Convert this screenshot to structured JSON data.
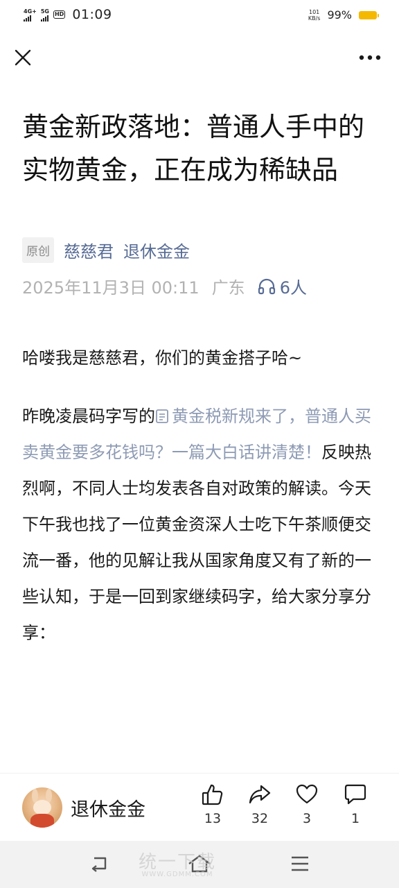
{
  "status_bar": {
    "net1": "4G+",
    "net2": "5G",
    "hd": "HD",
    "sim": "1 2",
    "time": "01:09",
    "speed_value": "101",
    "speed_unit": "KB/s",
    "battery_percent": "99%",
    "battery_color": "#f5b800"
  },
  "nav": {
    "close_icon": "close-icon",
    "more_icon": "more-horizontal-icon"
  },
  "article": {
    "title": "黄金新政落地：普通人手中的实物黄金，正在成为稀缺品",
    "original_tag": "原创",
    "author": "慈慈君",
    "account": "退休金金",
    "date": "2025年11月3日 00:11",
    "location": "广东",
    "listeners": "6人",
    "para1": "哈喽我是慈慈君，你们的黄金搭子哈~",
    "para2_before": "昨晚凌晨码字写的",
    "para2_link": "黄金税新规来了，普通人买卖黄金要多花钱吗？一篇大白话讲清楚！",
    "para2_after": "反映热烈啊，不同人士均发表各自对政策的解读。今天下午我也找了一位黄金资深人士吃下午茶顺便交流一番，他的见解让我从国家角度又有了新的一些认知，于是一回到家继续码字，给大家分享分享："
  },
  "action_bar": {
    "account_name": "退休金金",
    "like_count": "13",
    "share_count": "32",
    "favorite_count": "3",
    "comment_count": "1"
  },
  "watermark": {
    "main": "统一下载",
    "sub": "WWW.GDMM.COM"
  },
  "colors": {
    "link": "#576b95",
    "link_muted": "#8e9bb4",
    "meta_gray": "#b2b2b2"
  }
}
